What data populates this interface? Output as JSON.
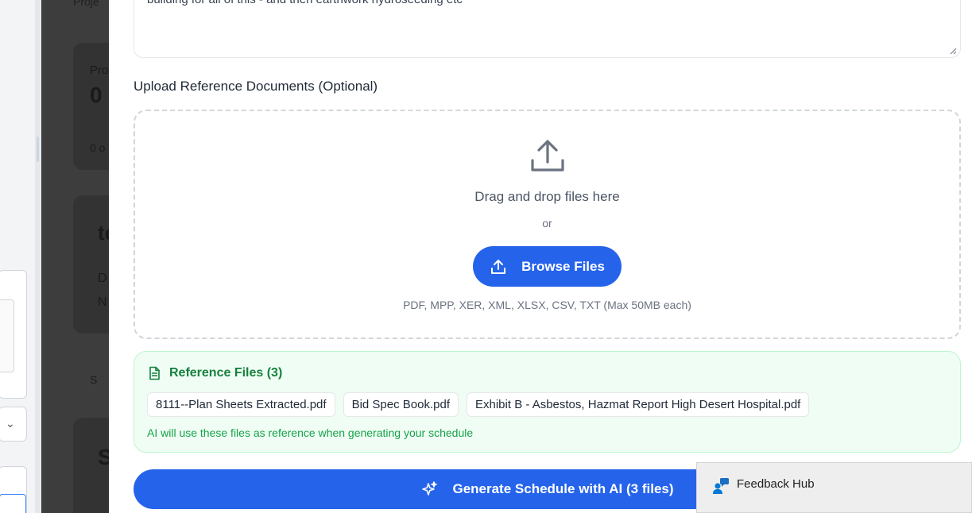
{
  "background": {
    "ghost_texts": [
      "Proje",
      "Pro",
      "0",
      "0 o",
      "te",
      "D",
      "N",
      "S",
      "S"
    ],
    "chevron_icon": "chevron-down-icon"
  },
  "modal": {
    "description_text": "building for all of this - and then earthwork hydroseeding etc",
    "upload_label": "Upload Reference Documents (Optional)",
    "dropzone": {
      "icon": "upload-icon",
      "drag_text": "Drag and drop files here",
      "or_text": "or",
      "browse_label": "Browse Files",
      "formats": "PDF, MPP, XER, XML, XLSX, CSV, TXT (Max 50MB each)"
    },
    "reference_files": {
      "icon": "file-text-icon",
      "title": "Reference Files (3)",
      "files": [
        "8111--Plan Sheets Extracted.pdf",
        "Bid Spec Book.pdf",
        "Exhibit B - Asbestos, Hazmat Report High Desert Hospital.pdf"
      ],
      "note": "AI will use these files as reference when generating your schedule"
    },
    "generate_label": "Generate Schedule with AI (3 files)"
  },
  "feedback_hub": {
    "title": "Feedback Hub"
  },
  "colors": {
    "primary": "#2563eb",
    "success": "#15803d",
    "success_bg": "#f0fdf4"
  }
}
